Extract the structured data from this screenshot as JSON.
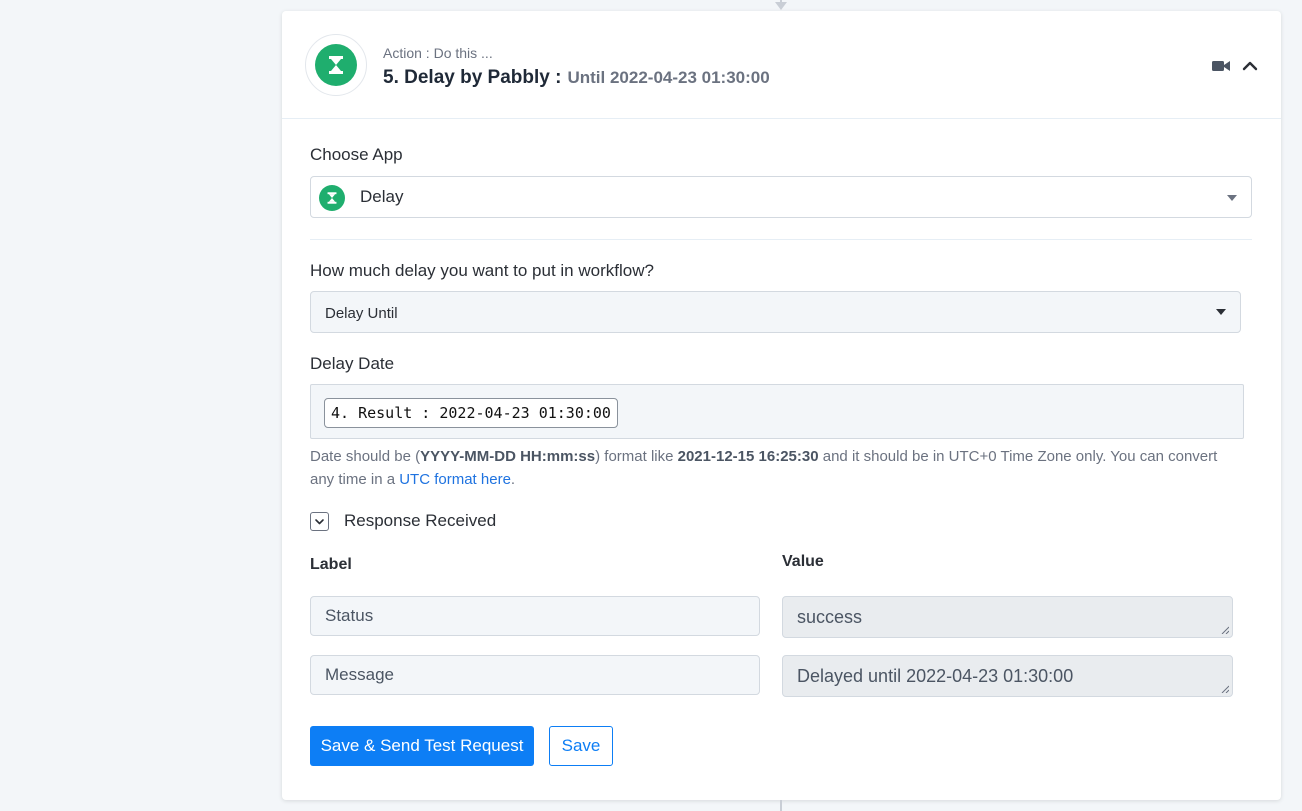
{
  "header": {
    "caption": "Action : Do this ...",
    "title": "5. Delay by Pabbly :",
    "subtitle": "Until 2022-04-23 01:30:00"
  },
  "choose_app": {
    "label": "Choose App",
    "value": "Delay"
  },
  "delay_type": {
    "label": "How much delay you want to put in workflow?",
    "value": "Delay Until"
  },
  "delay_date": {
    "label": "Delay Date",
    "chip": "4. Result : 2022-04-23 01:30:00"
  },
  "help": {
    "t1": "Date should be (",
    "b1": "YYYY-MM-DD HH:mm:ss",
    "t2": ") format like ",
    "b2": "2021-12-15 16:25:30",
    "t3": " and it should be in UTC+0 Time Zone only. You can convert any time in a ",
    "link": "UTC format here",
    "t4": "."
  },
  "response": {
    "label": "Response Received",
    "label_col": "Label",
    "value_col": "Value",
    "rows": [
      {
        "label": "Status",
        "value": "success"
      },
      {
        "label": "Message",
        "value": "Delayed until 2022-04-23 01:30:00"
      }
    ]
  },
  "buttons": {
    "primary": "Save & Send Test Request",
    "secondary": "Save"
  },
  "colors": {
    "accent": "#0d7ef5",
    "app_logo": "#1fae6e"
  },
  "icons": {
    "app": "hourglass-icon",
    "video": "video-camera-icon",
    "collapse": "chevron-up-icon",
    "toggle": "chevron-down-icon"
  }
}
